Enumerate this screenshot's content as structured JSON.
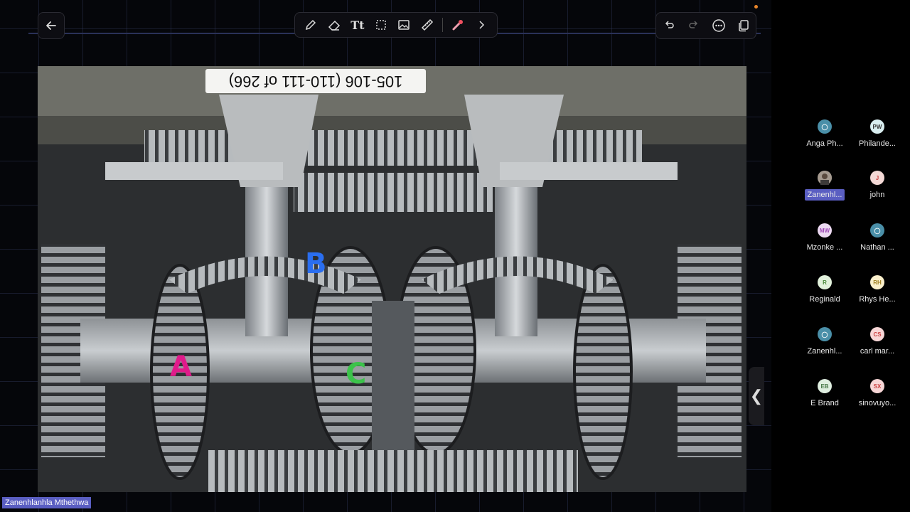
{
  "toolbar": {
    "back_icon": "back-arrow-icon",
    "tools": [
      {
        "name": "pen-tool",
        "icon": "pencil-icon"
      },
      {
        "name": "eraser-tool",
        "icon": "eraser-icon"
      },
      {
        "name": "text-tool",
        "icon": "text-icon",
        "glyph": "Tt"
      },
      {
        "name": "select-tool",
        "icon": "selection-icon"
      },
      {
        "name": "image-tool",
        "icon": "image-icon"
      },
      {
        "name": "ruler-tool",
        "icon": "ruler-icon"
      },
      {
        "name": "laser-pointer-tool",
        "icon": "laser-pointer-icon"
      }
    ],
    "expand_icon": "chevron-right-icon",
    "right": [
      "undo-icon",
      "redo-icon",
      "more-icon",
      "pages-icon"
    ],
    "accent_color": "#e8862a"
  },
  "slide": {
    "page_label": "105-106 (110-111 of 266)",
    "annotations": {
      "a": "A",
      "b": "B",
      "c": "C"
    },
    "annotation_colors": {
      "a": "#e01a8a",
      "b": "#2a6ef0",
      "c": "#3cc34b"
    }
  },
  "side_handle": "❮",
  "participants": [
    {
      "initials": "",
      "name": "Anga Ph...",
      "color": "#4a8fa8",
      "icon": "person-icon"
    },
    {
      "initials": "PW",
      "name": "Philande...",
      "color": "#d9eef0"
    },
    {
      "initials": "",
      "name": "Zanenhl...",
      "color": "#8a8a8a",
      "icon": "photo-avatar-icon",
      "active": true
    },
    {
      "initials": "J",
      "name": "john",
      "color": "#f4d9d6"
    },
    {
      "initials": "MW",
      "name": "Mzonke ...",
      "color": "#eddaf2"
    },
    {
      "initials": "",
      "name": "Nathan ...",
      "color": "#4a8fa8",
      "icon": "person-icon"
    },
    {
      "initials": "R",
      "name": "Reginald",
      "color": "#e2f2dc"
    },
    {
      "initials": "RH",
      "name": "Rhys He...",
      "color": "#fbf0cc"
    },
    {
      "initials": "",
      "name": "Zanenhl...",
      "color": "#4a8fa8",
      "icon": "person-icon"
    },
    {
      "initials": "CS",
      "name": "carl mar...",
      "color": "#f7d6d6"
    },
    {
      "initials": "EB",
      "name": "E Brand",
      "color": "#dfeee0"
    },
    {
      "initials": "SX",
      "name": "sinovuyo...",
      "color": "#f7d6d6"
    }
  ],
  "speaker": "Zanenhlanhla Mthethwa"
}
